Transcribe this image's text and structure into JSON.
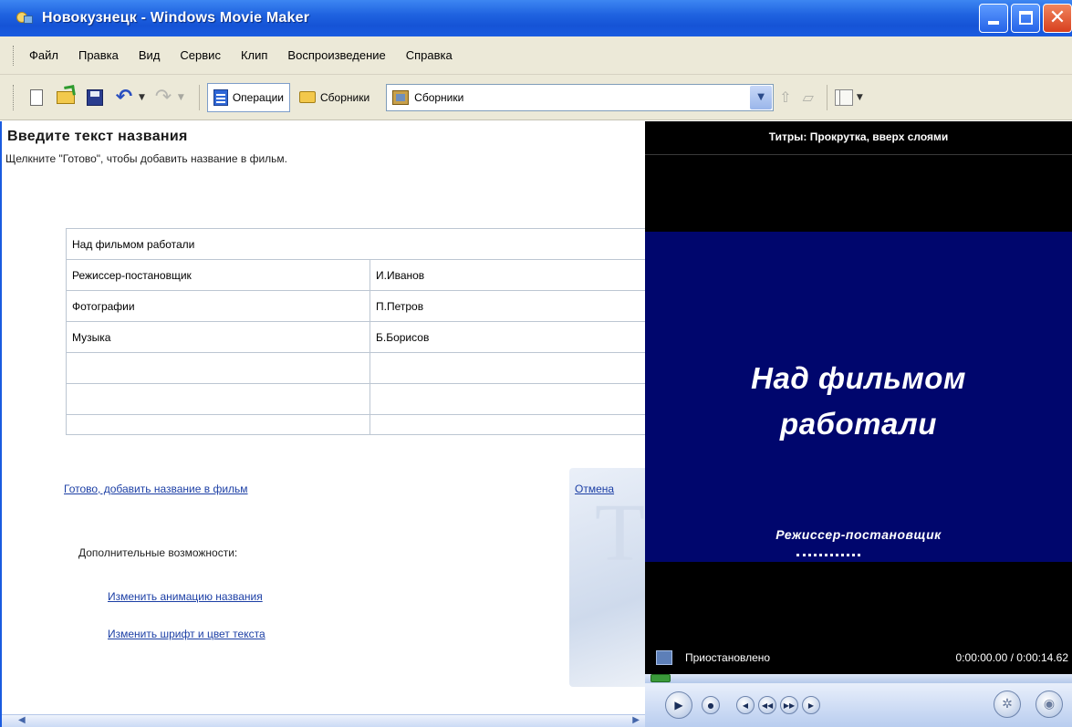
{
  "window": {
    "title": "Новокузнецк - Windows Movie Maker"
  },
  "menu": {
    "items": [
      "Файл",
      "Правка",
      "Вид",
      "Сервис",
      "Клип",
      "Воспроизведение",
      "Справка"
    ]
  },
  "toolbar": {
    "operations_label": "Операции",
    "collections_label": "Сборники",
    "collections_combo_value": "Сборники"
  },
  "panel": {
    "heading": "Введите текст названия",
    "subheading": "Щелкните \"Готово\", чтобы добавить название в фильм.",
    "credits_table": [
      [
        "Над фильмом работали",
        ""
      ],
      [
        "Режиссер-постановщик",
        "И.Иванов"
      ],
      [
        "Фотографии",
        "П.Петров"
      ],
      [
        "Музыка",
        "Б.Борисов"
      ],
      [
        "",
        ""
      ],
      [
        "",
        ""
      ],
      [
        "",
        ""
      ]
    ],
    "done_link": "Готово, добавить название в фильм",
    "cancel_link": "Отмена",
    "extra_options_label": "Дополнительные возможности:",
    "change_animation_link": "Изменить анимацию названия",
    "change_font_link": "Изменить шрифт и цвет текста"
  },
  "preview": {
    "title": "Титры: Прокрутка, вверх слоями",
    "screen_title_line1": "Над фильмом",
    "screen_title_line2": "работали",
    "screen_scroll_line": "Режиссер-постановщик",
    "status_text": "Приостановлено",
    "time": "0:00:00.00 / 0:00:14.62",
    "screen_color": "#00066d"
  },
  "colors": {
    "titlebar": "#1f63e0",
    "link": "#1c3fa5"
  }
}
